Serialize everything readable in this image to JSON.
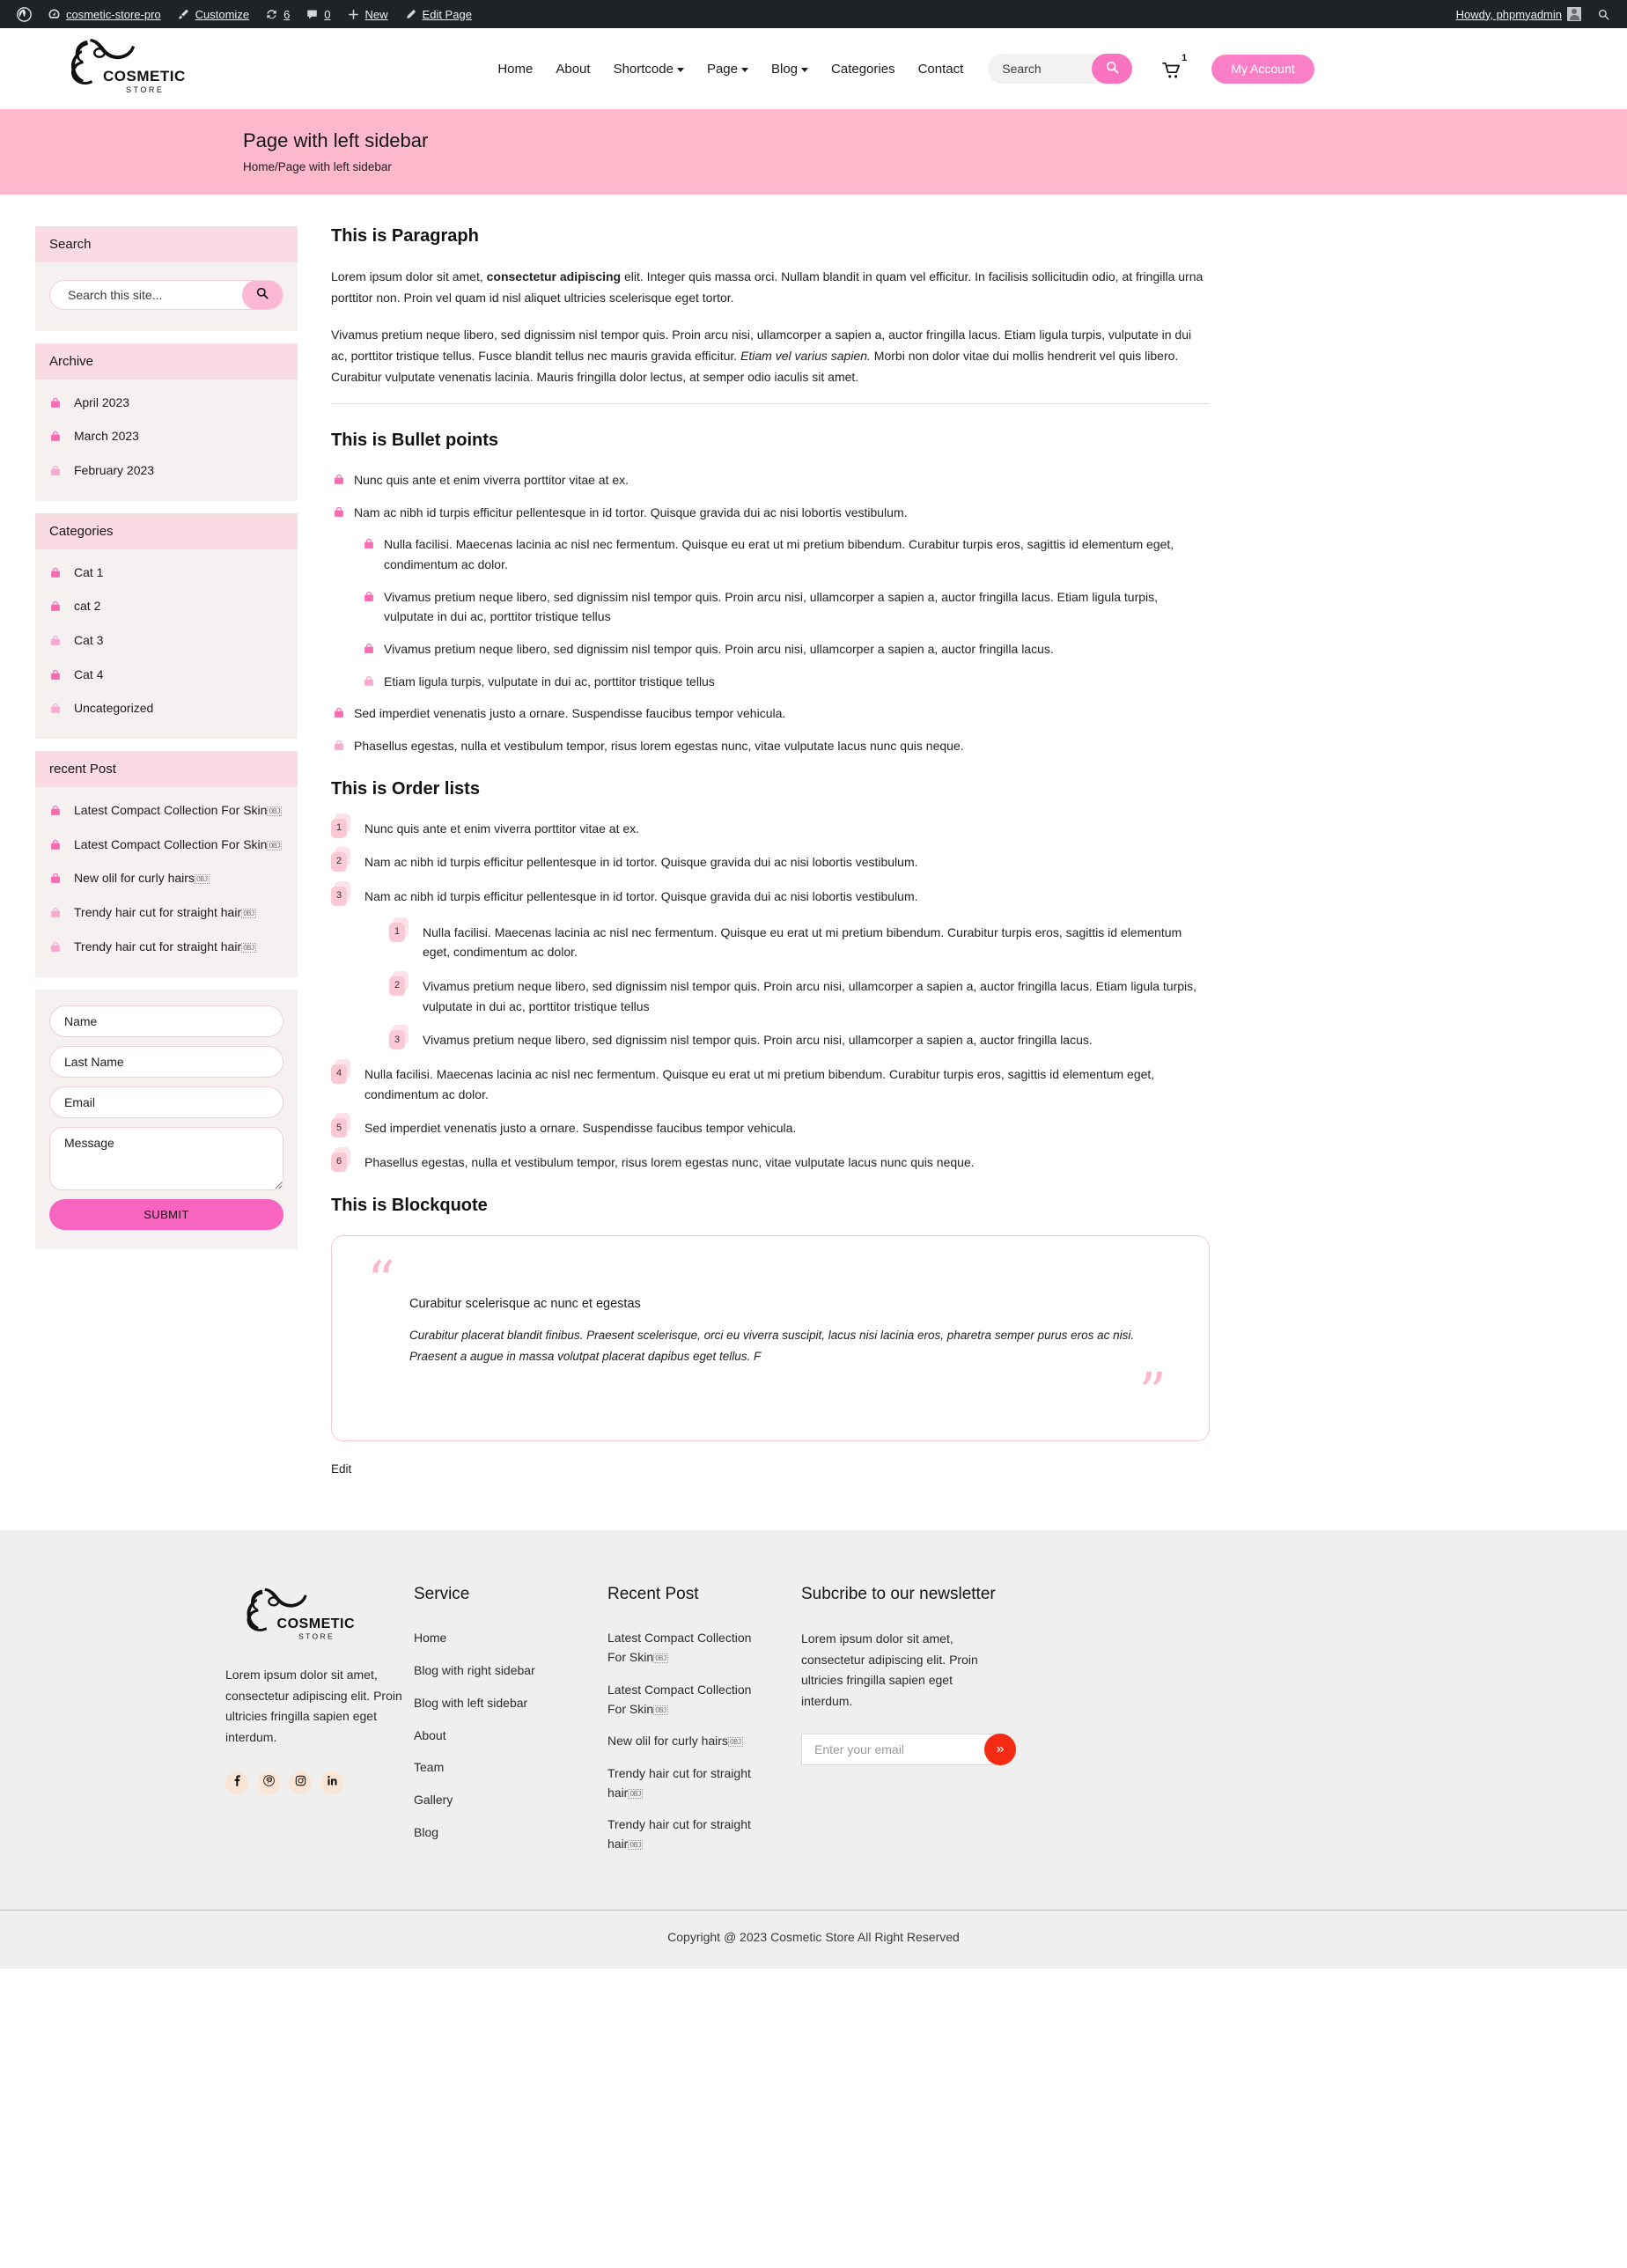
{
  "adminbar": {
    "site_name": "cosmetic-store-pro",
    "customize": "Customize",
    "updates_count": "6",
    "comments_count": "0",
    "new": "New",
    "edit_page": "Edit Page",
    "howdy": "Howdy, phpmyadmin"
  },
  "header": {
    "logo_main": "COSMETIC",
    "logo_sub": "STORE",
    "nav": [
      {
        "label": "Home",
        "has_caret": false
      },
      {
        "label": "About",
        "has_caret": false
      },
      {
        "label": "Shortcode",
        "has_caret": true
      },
      {
        "label": "Page",
        "has_caret": true
      },
      {
        "label": "Blog",
        "has_caret": true
      },
      {
        "label": "Categories",
        "has_caret": false
      },
      {
        "label": "Contact",
        "has_caret": false
      }
    ],
    "search_placeholder": "Search",
    "search_value": "",
    "cart_count": "1",
    "account_label": "My Account"
  },
  "banner": {
    "title": "Page with left sidebar",
    "breadcrumb": "Home/Page with left sidebar"
  },
  "sidebar": {
    "search_widget": {
      "title": "Search",
      "placeholder": "Search this site...",
      "value": ""
    },
    "archive_widget": {
      "title": "Archive",
      "items": [
        "April 2023",
        "March 2023",
        "February 2023"
      ]
    },
    "categories_widget": {
      "title": "Categories",
      "items": [
        "Cat 1",
        "cat 2",
        "Cat 3",
        "Cat 4",
        "Uncategorized"
      ]
    },
    "recent_widget": {
      "title": "recent Post",
      "items": [
        "Latest Compact Collection For Skin",
        "Latest Compact Collection For Skin",
        "New olil for curly hairs",
        "Trendy hair cut for straight hair",
        "Trendy hair cut for straight hair"
      ],
      "suffix_glyph": "OBJ"
    },
    "contact_form": {
      "name_placeholder": "Name",
      "lastname_placeholder": "Last Name",
      "email_placeholder": "Email",
      "message_placeholder": "Message",
      "submit_label": "SUBMIT"
    }
  },
  "content": {
    "paragraph_heading": "This is Paragraph",
    "para1_a": "Lorem ipsum dolor sit amet, ",
    "para1_bold": "consectetur adipiscing",
    "para1_b": " elit. Integer quis massa orci. Nullam blandit in quam vel efficitur. In facilisis sollicitudin odio, at fringilla urna porttitor non. Proin vel quam id nisl aliquet ultricies scelerisque eget tortor.",
    "para2_a": "Vivamus pretium neque libero, sed dignissim nisl tempor quis. Proin arcu nisi, ullamcorper a sapien a, auctor fringilla lacus. Etiam ligula turpis, vulputate in dui ac, porttitor tristique tellus. Fusce blandit tellus nec mauris gravida efficitur. ",
    "para2_italic": "Etiam vel varius sapien.",
    "para2_b": " Morbi non dolor vitae dui mollis hendrerit vel quis libero. Curabitur vulputate venenatis lacinia. Mauris fringilla dolor lectus, at semper odio iaculis sit amet.",
    "bullets_heading": "This is Bullet points",
    "bullets": [
      "Nunc quis ante et enim viverra porttitor vitae at ex.",
      "Nam ac nibh id turpis efficitur pellentesque in id tortor. Quisque gravida dui ac nisi lobortis vestibulum."
    ],
    "bullets_nested": [
      "Nulla facilisi. Maecenas lacinia ac nisl nec fermentum. Quisque eu erat ut mi pretium bibendum. Curabitur turpis eros, sagittis id elementum eget, condimentum ac dolor.",
      "Vivamus pretium neque libero, sed dignissim nisl tempor quis. Proin arcu nisi, ullamcorper a sapien a, auctor fringilla lacus. Etiam ligula turpis, vulputate in dui ac, porttitor tristique tellus",
      "Vivamus pretium neque libero, sed dignissim nisl tempor quis. Proin arcu nisi, ullamcorper a sapien a, auctor fringilla lacus.",
      "Etiam ligula turpis, vulputate in dui ac, porttitor tristique tellus"
    ],
    "bullets_tail": [
      "Sed imperdiet venenatis justo a ornare. Suspendisse faucibus tempor vehicula.",
      "Phasellus egestas, nulla et vestibulum tempor, risus lorem egestas nunc, vitae vulputate lacus nunc quis neque."
    ],
    "order_heading": "This is Order lists",
    "order_top": [
      {
        "n": "1",
        "text": "Nunc quis ante et enim viverra porttitor vitae at ex."
      },
      {
        "n": "2",
        "text": "Nam ac nibh id turpis efficitur pellentesque in id tortor. Quisque gravida dui ac nisi lobortis vestibulum."
      },
      {
        "n": "3",
        "text": "Nam ac nibh id turpis efficitur pellentesque in id tortor. Quisque gravida dui ac nisi lobortis vestibulum."
      }
    ],
    "order_nested": [
      {
        "n": "1",
        "text": "Nulla facilisi. Maecenas lacinia ac nisl nec fermentum. Quisque eu erat ut mi pretium bibendum. Curabitur turpis eros, sagittis id elementum eget, condimentum ac dolor."
      },
      {
        "n": "2",
        "text": "Vivamus pretium neque libero, sed dignissim nisl tempor quis. Proin arcu nisi, ullamcorper a sapien a, auctor fringilla lacus. Etiam ligula turpis, vulputate in dui ac, porttitor tristique tellus"
      },
      {
        "n": "3",
        "text": "Vivamus pretium neque libero, sed dignissim nisl tempor quis. Proin arcu nisi, ullamcorper a sapien a, auctor fringilla lacus."
      }
    ],
    "order_tail": [
      {
        "n": "4",
        "text": "Nulla facilisi. Maecenas lacinia ac nisl nec fermentum. Quisque eu erat ut mi pretium bibendum. Curabitur turpis eros, sagittis id elementum eget, condimentum ac dolor."
      },
      {
        "n": "5",
        "text": "Sed imperdiet venenatis justo a ornare. Suspendisse faucibus tempor vehicula."
      },
      {
        "n": "6",
        "text": "Phasellus egestas, nulla et vestibulum tempor, risus lorem egestas nunc, vitae vulputate lacus nunc quis neque."
      }
    ],
    "blockquote_heading": "This is Blockquote",
    "blockquote_open": "“",
    "blockquote_close": "”",
    "blockquote_title": "Curabitur scelerisque ac nunc et egestas",
    "blockquote_text": "Curabitur placerat blandit finibus. Praesent scelerisque, orci eu viverra suscipit, lacus nisi lacinia eros, pharetra semper purus eros ac nisi. Praesent a augue in massa volutpat placerat dapibus eget tellus. F",
    "edit_label": "Edit"
  },
  "footer": {
    "logo_main": "COSMETIC",
    "logo_sub": "STORE",
    "about_text": "Lorem ipsum dolor sit amet, consectetur adipiscing elit. Proin ultricies fringilla sapien eget interdum.",
    "socials": [
      "facebook-icon",
      "pinterest-icon",
      "instagram-icon",
      "linkedin-icon"
    ],
    "service": {
      "title": "Service",
      "items": [
        "Home",
        "Blog with right sidebar",
        "Blog with left sidebar",
        "About",
        "Team",
        "Gallery",
        "Blog"
      ]
    },
    "recent": {
      "title": "Recent Post",
      "items": [
        "Latest Compact Collection For Skin",
        "Latest Compact Collection For Skin",
        "New olil for curly hairs",
        "Trendy hair cut for straight hair",
        "Trendy hair cut for straight hair"
      ],
      "suffix_glyph": "OBJ"
    },
    "newsletter": {
      "title": "Subcribe to our newsletter",
      "desc": "Lorem ipsum dolor sit amet, consectetur adipiscing elit. Proin ultricies fringilla sapien eget interdum.",
      "placeholder": "Enter your email",
      "value": "",
      "submit_glyph": "»"
    },
    "copyright": "Copyright @ 2023 Cosmetic Store All Right Reserved"
  },
  "colors": {
    "accent_pink": "#fb7fc7",
    "banner_pink": "#ffb9cd",
    "widget_head": "#fadbe3",
    "widget_body": "#f6f1f1",
    "admin_bar": "#1d2327",
    "newsletter_btn": "#f52a12"
  }
}
